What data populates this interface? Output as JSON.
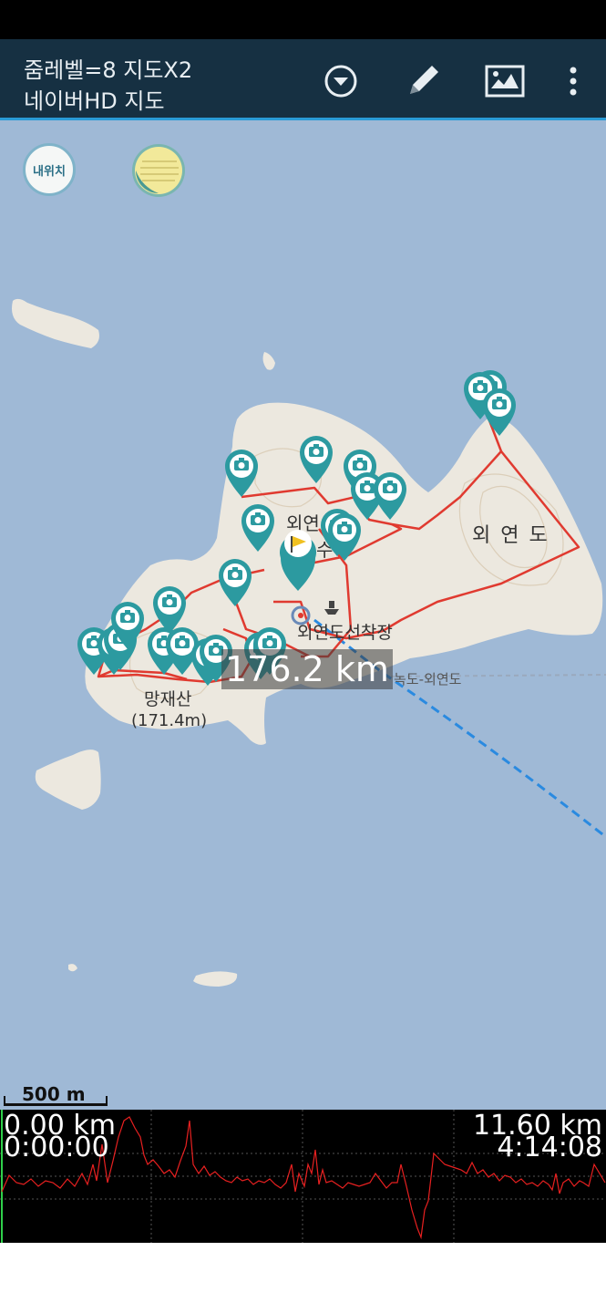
{
  "header": {
    "line1": "줌레벨=8 지도X2",
    "line2": "네이버HD 지도"
  },
  "toolbar": {
    "buttons": [
      {
        "name": "dropdown-circle-icon"
      },
      {
        "name": "pencil-icon"
      },
      {
        "name": "map-image-icon"
      },
      {
        "name": "more-vert-icon"
      }
    ]
  },
  "map": {
    "my_location_label": "내위치",
    "distance_label": "176.2 km",
    "labels": {
      "island_east": "외 연 도",
      "village": "외연",
      "village2": "수",
      "pier": "외연도선착장",
      "ferry_route": "녹도-외연도",
      "mountain": "망재산",
      "mountain_height": "(171.4m)"
    },
    "scale": "500 m",
    "colors": {
      "sea": "#9fb9d6",
      "land": "#ece8df",
      "track": "#e03a30",
      "marker": "#2c9aa0",
      "route": "#2a8ae0"
    }
  },
  "elevation": {
    "start_distance": "0.00 km",
    "start_time": "0:00:00",
    "end_distance": "11.60 km",
    "end_time": "4:14:08"
  }
}
